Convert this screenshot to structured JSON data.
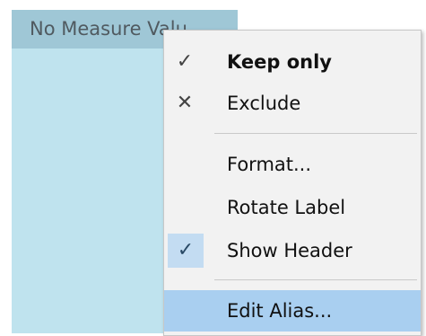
{
  "header": {
    "cell_text": "No Measure Valu"
  },
  "menu": {
    "items": [
      {
        "id": "keep-only",
        "label": "Keep only",
        "icon": "checkmark-icon",
        "icon_glyph": "✓",
        "bold": true
      },
      {
        "id": "exclude",
        "label": "Exclude",
        "icon": "close-icon",
        "icon_glyph": "✕",
        "bold": false
      },
      {
        "id": "format",
        "label": "Format...",
        "icon": "",
        "icon_glyph": "",
        "bold": false
      },
      {
        "id": "rotate-label",
        "label": "Rotate Label",
        "icon": "",
        "icon_glyph": "",
        "bold": false
      },
      {
        "id": "show-header",
        "label": "Show Header",
        "icon": "checked-state-icon",
        "icon_glyph": "✓",
        "bold": false,
        "checked": true
      },
      {
        "id": "edit-alias",
        "label": "Edit Alias...",
        "icon": "",
        "icon_glyph": "",
        "bold": false,
        "hovered": true
      }
    ]
  },
  "colors": {
    "header_pane": "#bfe3ee",
    "header_cell": "#9fc7d6",
    "menu_bg": "#f2f2f2",
    "hover_highlight": "#a9cff0",
    "checked_box": "#c3dcf2"
  }
}
